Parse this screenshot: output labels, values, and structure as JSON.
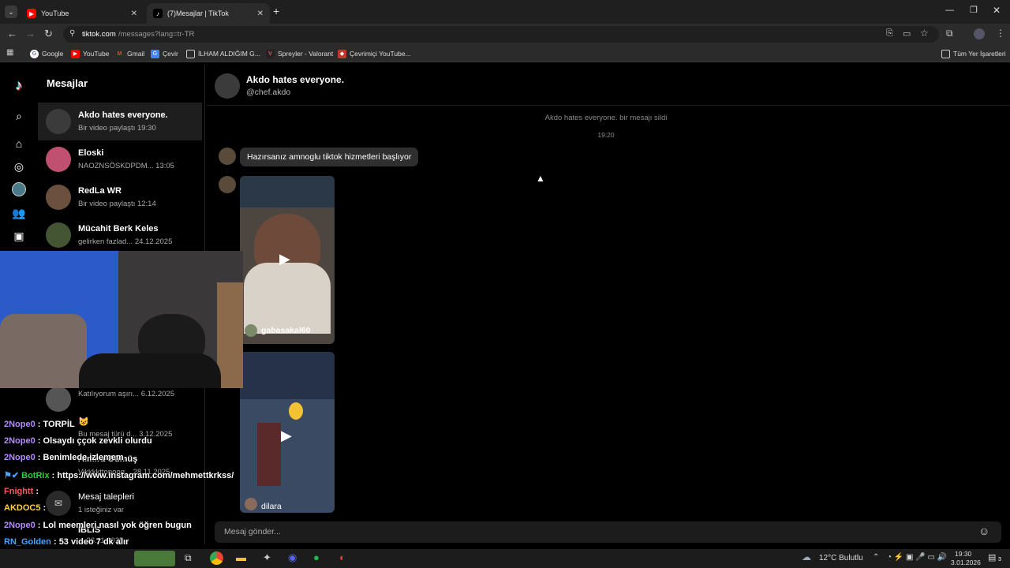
{
  "browser": {
    "tabs": [
      {
        "title": "YouTube",
        "active": false
      },
      {
        "title": "(7)Mesajlar | TikTok",
        "active": true
      }
    ],
    "url_host": "tiktok.com",
    "url_path": "/messages?lang=tr-TR",
    "bookmarks": [
      "Google",
      "YouTube",
      "Gmail",
      "Çevir",
      "İLHAM ALDIĞIM G...",
      "Spreyler - Valorant",
      "Çevrimiçi YouTube..."
    ],
    "all_bookmarks": "Tüm Yer İşaretleri"
  },
  "sidebar": {
    "title": "Mesajlar",
    "conversations": [
      {
        "name": "Akdo hates everyone.",
        "preview": "Bir video paylaştı 19:30",
        "active": true
      },
      {
        "name": "Eloski",
        "preview": "NAOZNSÖSKDPDM... 13:05"
      },
      {
        "name": "RedLa WR",
        "preview": "Bir video paylaştı 12:14"
      },
      {
        "name": "Mücahit Berk Keles",
        "preview": "gelirken fazlad... 24.12.2025"
      },
      {
        "name": "",
        "preview": "Katılıyorum aşırı... 6.12.2025"
      },
      {
        "name": "😺",
        "preview": "Bu mesaj türü d... 3.12.2025"
      },
      {
        "name": "Almira Gümüş",
        "preview": "Vikkkkttopoog... 28.11.2025"
      },
      {
        "name": "Mesaj talepleri",
        "preview": "1 isteğiniz var"
      },
      {
        "name": "IBLIS",
        "preview": "... 26.11.2025"
      }
    ]
  },
  "chat": {
    "header_name": "Akdo hates everyone.",
    "header_handle": "@chef.akdo",
    "system_notice": "Akdo hates everyone. bir mesajı sildi",
    "timestamp": "19:20",
    "text_message": "Hazırsanız amnoglu tiktok hizmetleri başlıyor",
    "videos": [
      {
        "author": "gabasakal60"
      },
      {
        "author": "dilara"
      }
    ],
    "composer_placeholder": "Mesaj gönder..."
  },
  "stream_chat": [
    {
      "user": "2Nope0",
      "text": "TORPİL",
      "color": "#b48cff"
    },
    {
      "user": "2Nope0",
      "text": "Olsaydı ççok zevkli olurdu",
      "color": "#b48cff"
    },
    {
      "user": "2Nope0",
      "text": "Benimlede izlemem",
      "color": "#b48cff"
    },
    {
      "user": "BotRix",
      "text": "https://www.instagram.com/mehmettkrkss/",
      "color": "#2ecc40"
    },
    {
      "user": "Fnightt",
      "text": "",
      "color": "#ff5a5a"
    },
    {
      "user": "AKDOC5",
      "text": "",
      "color": "#ffd24a"
    },
    {
      "user": "2Nope0",
      "text": "Lol meemleri nasıl yok öğren bugun",
      "color": "#b48cff"
    },
    {
      "user": "RN_Golden",
      "text": "53 video 7 dk alır",
      "color": "#4aa3ff"
    }
  ],
  "taskbar": {
    "weather": "12°C Bulutlu",
    "time": "19:30",
    "date": "3.01.2026",
    "notif_count": "3"
  }
}
